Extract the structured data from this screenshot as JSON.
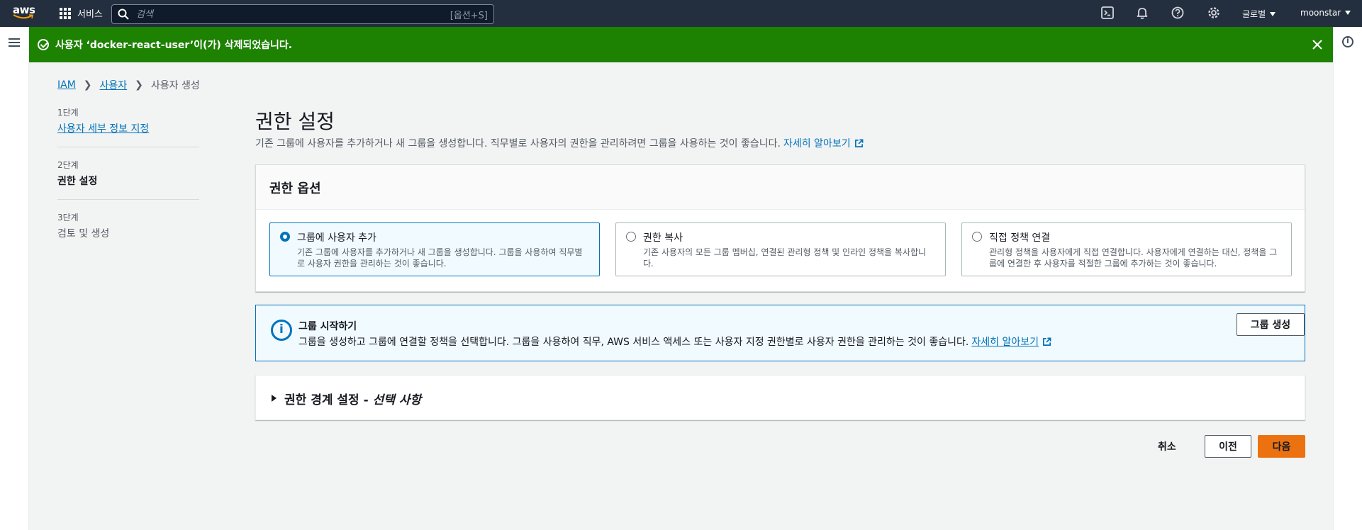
{
  "topnav": {
    "logo_text": "aws",
    "services_label": "서비스",
    "search_placeholder": "검색",
    "search_shortcut": "[옵션+S]",
    "region_label": "글로벌",
    "account_label": "moonstar"
  },
  "flash": {
    "message": "사용자 ‘docker-react-user’이(가) 삭제되었습니다."
  },
  "breadcrumb": {
    "items": [
      "IAM",
      "사용자",
      "사용자 생성"
    ]
  },
  "steps": [
    {
      "num": "1단계",
      "label": "사용자 세부 정보 지정"
    },
    {
      "num": "2단계",
      "label": "권한 설정"
    },
    {
      "num": "3단계",
      "label": "검토 및 생성"
    }
  ],
  "page": {
    "title": "권한 설정",
    "description": "기존 그룹에 사용자를 추가하거나 새 그룹을 생성합니다. 직무별로 사용자의 권한을 관리하려면 그룹을 사용하는 것이 좋습니다.",
    "learn_more": "자세히 알아보기"
  },
  "permission_options": {
    "header": "권한 옵션",
    "tiles": [
      {
        "title": "그룹에 사용자 추가",
        "desc": "기존 그룹에 사용자를 추가하거나 새 그룹을 생성합니다. 그룹을 사용하여 직무별로 사용자 권한을 관리하는 것이 좋습니다.",
        "selected": true
      },
      {
        "title": "권한 복사",
        "desc": "기존 사용자의 모든 그룹 멤버십, 연결된 관리형 정책 및 인라인 정책을 복사합니다.",
        "selected": false
      },
      {
        "title": "직접 정책 연결",
        "desc": "관리형 정책을 사용자에게 직접 연결합니다. 사용자에게 연결하는 대신, 정책을 그룹에 연결한 후 사용자를 적절한 그룹에 추가하는 것이 좋습니다.",
        "selected": false
      }
    ]
  },
  "info_box": {
    "title": "그룹 시작하기",
    "text": "그룹을 생성하고 그룹에 연결할 정책을 선택합니다. 그룹을 사용하여 직무, AWS 서비스 액세스 또는 사용자 지정 권한별로 사용자 권한을 관리하는 것이 좋습니다.",
    "learn_more": "자세히 알아보기",
    "button": "그룹 생성"
  },
  "boundary": {
    "title_main": "권한 경계 설정 - ",
    "title_italic": "선택 사항"
  },
  "footer": {
    "cancel": "취소",
    "previous": "이전",
    "next": "다음"
  },
  "colors": {
    "nav_bg": "#232f3e",
    "success": "#1d8102",
    "link": "#0073bb",
    "primary_button": "#ec7211"
  }
}
